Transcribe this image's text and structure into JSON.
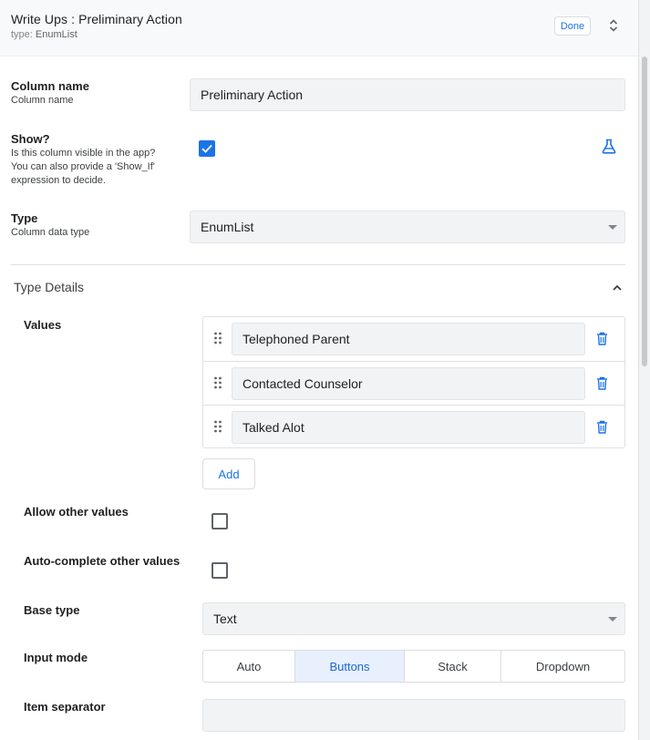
{
  "header": {
    "title": "Write Ups : Preliminary Action",
    "subtitle_key": "type:",
    "subtitle_value": "EnumList",
    "done_label": "Done"
  },
  "column_name": {
    "label": "Column name",
    "help": "Column name",
    "value": "Preliminary Action"
  },
  "show": {
    "label": "Show?",
    "help_lines": [
      "Is this column visible in the app?",
      "You can also provide a 'Show_If'",
      "expression to decide."
    ],
    "checked": true
  },
  "type": {
    "label": "Type",
    "help": "Column data type",
    "value": "EnumList"
  },
  "type_details": {
    "title": "Type Details",
    "values_label": "Values",
    "values": [
      "Telephoned Parent",
      "Contacted Counselor",
      "Talked Alot"
    ],
    "add_label": "Add",
    "allow_other_label": "Allow other values",
    "allow_other_checked": false,
    "autocomplete_label": "Auto-complete other values",
    "autocomplete_checked": false,
    "base_type_label": "Base type",
    "base_type_value": "Text",
    "input_mode_label": "Input mode",
    "input_mode_options": [
      "Auto",
      "Buttons",
      "Stack",
      "Dropdown"
    ],
    "input_mode_selected": "Buttons",
    "item_separator_label": "Item separator",
    "item_separator_value": ""
  },
  "colors": {
    "accent": "#1a73e8",
    "active_segment_bg": "#e8f0fe",
    "field_bg": "#f1f3f4"
  },
  "icons": {
    "expand": "unfold-more-icon",
    "formula": "flask-icon",
    "collapse": "chevron-up-icon",
    "drag": "drag-handle-icon",
    "delete": "trash-icon"
  }
}
